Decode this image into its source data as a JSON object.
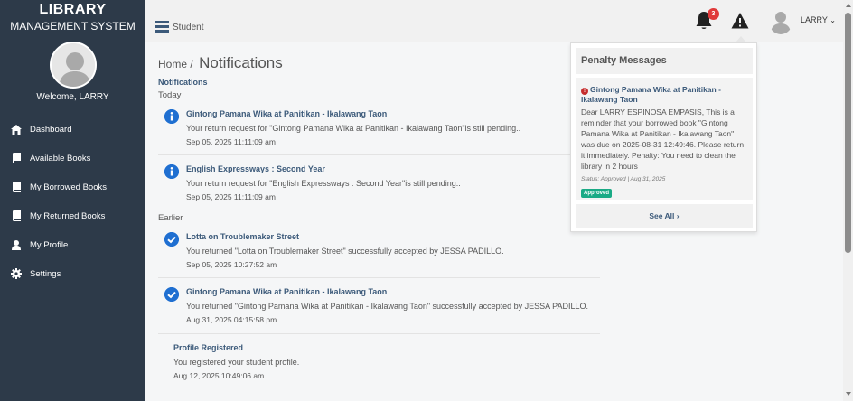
{
  "sidebar": {
    "brand_top": "LIBRARY",
    "brand_bottom": "MANAGEMENT SYSTEM",
    "welcome": "Welcome, LARRY",
    "items": [
      {
        "label": "Dashboard",
        "icon": "home-icon"
      },
      {
        "label": "Available Books",
        "icon": "book-icon"
      },
      {
        "label": "My Borrowed Books",
        "icon": "book-icon"
      },
      {
        "label": "My Returned Books",
        "icon": "book-icon"
      },
      {
        "label": "My Profile",
        "icon": "user-icon"
      },
      {
        "label": "Settings",
        "icon": "gear-icon"
      }
    ]
  },
  "topbar": {
    "title": "Student",
    "notification_count": "3",
    "user_name": "LARRY",
    "user_caret": "⌄"
  },
  "breadcrumb": {
    "home": "Home /",
    "current": "Notifications"
  },
  "notifications": {
    "section_label": "Notifications",
    "today_label": "Today",
    "earlier_label": "Earlier",
    "today": [
      {
        "title": "Gintong Pamana Wika at Panitikan - Ikalawang Taon",
        "message": "Your return request for \"Gintong Pamana Wika at Panitikan - Ikalawang Taon\"is still pending..",
        "time": "Sep 05, 2025 11:11:09 am",
        "icon": "info-icon"
      },
      {
        "title": "English Expressways : Second Year",
        "message": "Your return request for \"English Expressways : Second Year\"is still pending..",
        "time": "Sep 05, 2025 11:11:09 am",
        "icon": "info-icon"
      }
    ],
    "earlier": [
      {
        "title": "Lotta on Troublemaker Street",
        "message": "You returned \"Lotta on Troublemaker Street\" successfully accepted by JESSA PADILLO.",
        "time": "Sep 05, 2025 10:27:52 am",
        "icon": "check-icon"
      },
      {
        "title": "Gintong Pamana Wika at Panitikan - Ikalawang Taon",
        "message": "You returned \"Gintong Pamana Wika at Panitikan - Ikalawang Taon\" successfully accepted by JESSA PADILLO.",
        "time": "Aug 31, 2025 04:15:58 pm",
        "icon": "check-icon"
      },
      {
        "title": "Profile Registered",
        "message": "You registered your student profile.",
        "time": "Aug 12, 2025 10:49:06 am",
        "icon": ""
      }
    ]
  },
  "penalty": {
    "header": "Penalty Messages",
    "item_title": "Gintong Pamana Wika at Panitikan - Ikalawang Taon",
    "item_body": "Dear LARRY ESPINOSA EMPASIS, This is a reminder that your borrowed book \"Gintong Pamana Wika at Panitikan - Ikalawang Taon\" was due on 2025-08-31 12:49:46. Please return it immediately. Penalty: You need to clean the library in 2 hours",
    "item_status": "Status: Approved | Aug 31, 2025",
    "item_badge": "Approved",
    "see_all": "See All ›"
  },
  "colors": {
    "sidebar_bg": "#2d3a49",
    "accent_blue": "#1f6fd1",
    "title_blue": "#3c5a7a",
    "badge_red": "#e03a3a",
    "approved_green": "#1aaa85"
  }
}
